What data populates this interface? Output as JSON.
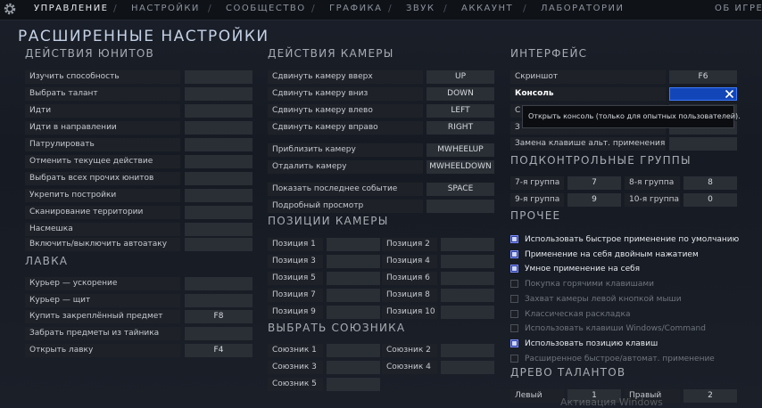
{
  "nav": {
    "tabs": [
      "УПРАВЛЕНИЕ",
      "НАСТРОЙКИ",
      "СООБЩЕСТВО",
      "ГРАФИКА",
      "ЗВУК",
      "АККАУНТ",
      "ЛАБОРАТОРИИ"
    ],
    "about": "ОБ ИГРЕ",
    "active_index": 0
  },
  "page_title": "РАСШИРЕННЫЕ НАСТРОЙКИ",
  "unit_actions": {
    "title": "ДЕЙСТВИЯ ЮНИТОВ",
    "rows": [
      {
        "label": "Изучить способность",
        "key": ""
      },
      {
        "label": "Выбрать талант",
        "key": ""
      },
      {
        "label": "Идти",
        "key": ""
      },
      {
        "label": "Идти в направлении",
        "key": ""
      },
      {
        "label": "Патрулировать",
        "key": ""
      },
      {
        "label": "Отменить текущее действие",
        "key": ""
      },
      {
        "label": "Выбрать всех прочих юнитов",
        "key": ""
      },
      {
        "label": "Укрепить постройки",
        "key": ""
      },
      {
        "label": "Сканирование территории",
        "key": ""
      },
      {
        "label": "Насмешка",
        "key": ""
      },
      {
        "label": "Включить/выключить автоатаку",
        "key": ""
      }
    ]
  },
  "shop": {
    "title": "ЛАВКА",
    "rows": [
      {
        "label": "Курьер — ускорение",
        "key": ""
      },
      {
        "label": "Курьер — щит",
        "key": ""
      },
      {
        "label": "Купить закреплённый предмет",
        "key": "F8"
      },
      {
        "label": "Забрать предметы из тайника",
        "key": ""
      },
      {
        "label": "Открыть лавку",
        "key": "F4"
      }
    ]
  },
  "camera_actions": {
    "title": "ДЕЙСТВИЯ КАМЕРЫ",
    "rows": [
      {
        "label": "Сдвинуть камеру вверх",
        "key": "UP"
      },
      {
        "label": "Сдвинуть камеру вниз",
        "key": "DOWN"
      },
      {
        "label": "Сдвинуть камеру влево",
        "key": "LEFT"
      },
      {
        "label": "Сдвинуть камеру вправо",
        "key": "RIGHT"
      },
      {
        "label": "Приблизить камеру",
        "key": "MWHEELUP"
      },
      {
        "label": "Отдалить камеру",
        "key": "MWHEELDOWN"
      },
      {
        "label": "Показать последнее событие",
        "key": "SPACE"
      },
      {
        "label": "Подробный просмотр",
        "key": ""
      }
    ]
  },
  "camera_positions": {
    "title": "ПОЗИЦИИ КАМЕРЫ",
    "items": [
      {
        "label": "Позиция 1",
        "key": ""
      },
      {
        "label": "Позиция 2",
        "key": ""
      },
      {
        "label": "Позиция 3",
        "key": ""
      },
      {
        "label": "Позиция 4",
        "key": ""
      },
      {
        "label": "Позиция 5",
        "key": ""
      },
      {
        "label": "Позиция 6",
        "key": ""
      },
      {
        "label": "Позиция 7",
        "key": ""
      },
      {
        "label": "Позиция 8",
        "key": ""
      },
      {
        "label": "Позиция 9",
        "key": ""
      },
      {
        "label": "Позиция 10",
        "key": ""
      }
    ]
  },
  "select_ally": {
    "title": "ВЫБРАТЬ СОЮЗНИКА",
    "items": [
      {
        "label": "Союзник 1",
        "key": ""
      },
      {
        "label": "Союзник 2",
        "key": ""
      },
      {
        "label": "Союзник 3",
        "key": ""
      },
      {
        "label": "Союзник 4",
        "key": ""
      },
      {
        "label": "Союзник 5",
        "key": ""
      }
    ]
  },
  "interface": {
    "title": "ИНТЕРФЕЙС",
    "rows": [
      {
        "label": "Скриншот",
        "key": "F6"
      },
      {
        "label": "Консоль",
        "key": ""
      },
      {
        "label": "С",
        "key": ""
      },
      {
        "label": "З",
        "key": ""
      },
      {
        "label": "Замена клавише альт. применения",
        "key": ""
      }
    ],
    "tooltip": "Открыть консоль (только для опытных пользователей)."
  },
  "control_groups": {
    "title": "ПОДКОНТРОЛЬНЫЕ ГРУППЫ",
    "items": [
      {
        "label": "7-я группа",
        "key": "7"
      },
      {
        "label": "8-я группа",
        "key": "8"
      },
      {
        "label": "9-я группа",
        "key": "9"
      },
      {
        "label": "10-я группа",
        "key": "0"
      }
    ]
  },
  "other": {
    "title": "ПРОЧЕЕ",
    "options": [
      {
        "label": "Использовать быстрое применение по умолчанию",
        "checked": true
      },
      {
        "label": "Применение на себя двойным нажатием",
        "checked": true
      },
      {
        "label": "Умное применение на себя",
        "checked": true
      },
      {
        "label": "Покупка горячими клавишами",
        "checked": false
      },
      {
        "label": "Захват камеры левой кнопкой мыши",
        "checked": false
      },
      {
        "label": "Классическая раскладка",
        "checked": false
      },
      {
        "label": "Использовать клавиши Windows/Command",
        "checked": false
      },
      {
        "label": "Использовать позицию клавиш",
        "checked": true
      },
      {
        "label": "Расширенное быстрое/автомат. применение",
        "checked": false
      }
    ]
  },
  "talent_tree": {
    "title": "ДРЕВО ТАЛАНТОВ",
    "items": [
      {
        "label": "Левый",
        "key": "1"
      },
      {
        "label": "Правый",
        "key": "2"
      }
    ]
  },
  "watermark": "Активация Windows"
}
